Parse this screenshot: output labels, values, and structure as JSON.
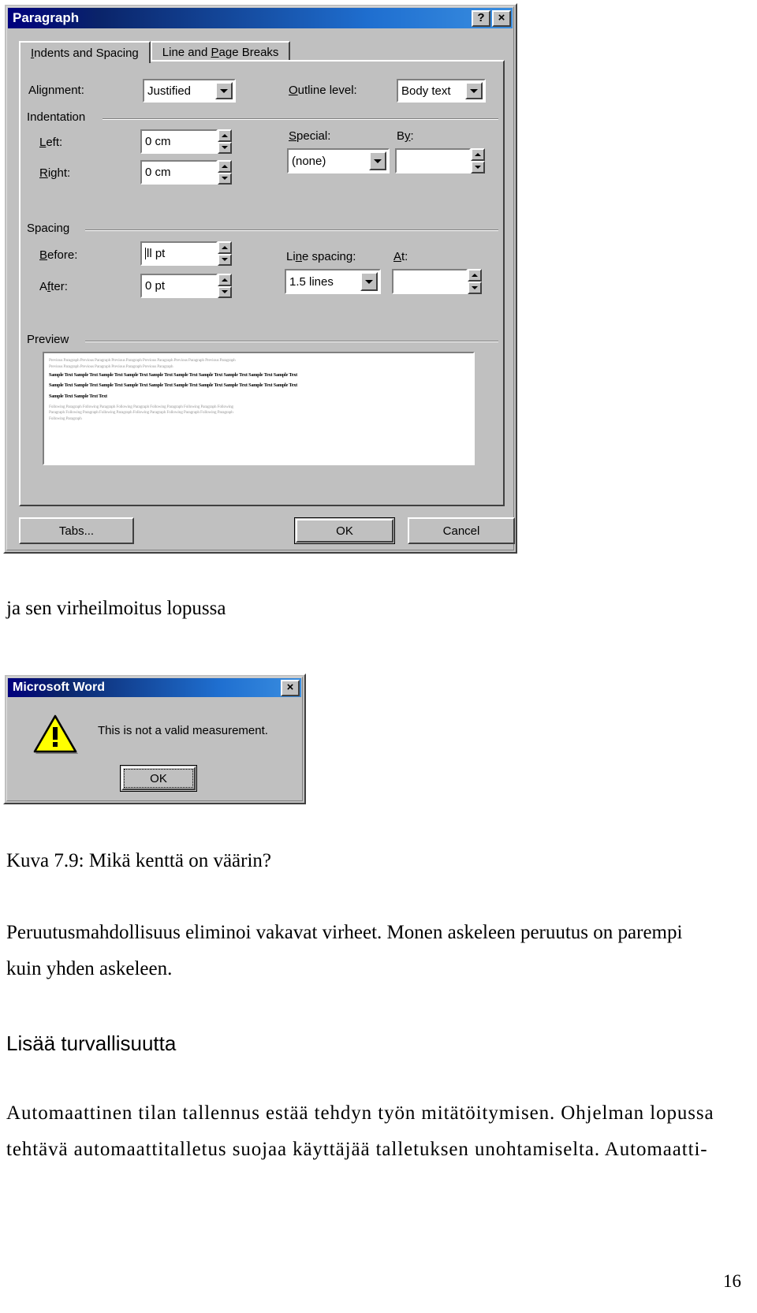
{
  "paragraph_dialog": {
    "title": "Paragraph",
    "help_button": "?",
    "close_button": "×",
    "tabs": [
      {
        "label": "Indents and Spacing",
        "accel": "I",
        "active": true
      },
      {
        "label": "Line and Page Breaks",
        "accel": "P",
        "active": false
      }
    ],
    "alignment": {
      "label": "Alignment:",
      "accel": "g",
      "value": "Justified"
    },
    "outline_level": {
      "label": "Outline level:",
      "accel": "O",
      "value": "Body text"
    },
    "indentation": {
      "group_label": "Indentation",
      "left": {
        "label": "Left:",
        "accel": "L",
        "value": "0 cm"
      },
      "right": {
        "label": "Right:",
        "accel": "R",
        "value": "0 cm"
      },
      "special": {
        "label": "Special:",
        "accel": "S",
        "value": "(none)"
      },
      "by": {
        "label": "By:",
        "accel": "y",
        "value": ""
      }
    },
    "spacing": {
      "group_label": "Spacing",
      "before": {
        "label": "Before:",
        "accel": "B",
        "value": "ll pt"
      },
      "after": {
        "label": "After:",
        "accel": "f",
        "value": "0 pt"
      },
      "line_spacing": {
        "label": "Line spacing:",
        "accel": "n",
        "value": "1.5 lines"
      },
      "at": {
        "label": "At:",
        "accel": "A",
        "value": ""
      }
    },
    "preview": {
      "group_label": "Preview",
      "previous_lines": [
        "Previous Paragraph Previous Paragraph Previous Paragraph Previous Paragraph Previous Paragraph Previous Paragraph",
        "Previous Paragraph Previous Paragraph Previous Paragraph Previous Paragraph"
      ],
      "sample_lines": [
        "Sample Text Sample Text Sample Text Sample Text Sample Text Sample Text Sample Text Sample Text Sample Text Sample Text",
        "Sample Text  Sample Text  Sample Text  Sample Text  Sample Text  Sample Text  Sample Text  Sample Text  Sample Text  Sample Text",
        "Sample Text Sample Text Text"
      ],
      "following_lines": [
        "Following Paragraph Following Paragraph Following Paragraph Following Paragraph Following Paragraph Following",
        "Paragraph Following Paragraph Following Paragraph Following Paragraph Following Paragraph Following Paragraph",
        "Following Paragraph"
      ]
    },
    "buttons": {
      "tabs": "Tabs...",
      "ok": "OK",
      "cancel": "Cancel"
    }
  },
  "word_dialog": {
    "title": "Microsoft Word",
    "close_button": "×",
    "icon": "warning-triangle-icon",
    "message": "This is not a valid measurement.",
    "ok_button": "OK"
  },
  "document": {
    "caption_above": "ja sen virheilmoitus lopussa",
    "figure_caption": "Kuva 7.9: Mikä kenttä on väärin?",
    "paragraph_1_line_1": "Peruutusmahdollisuus eliminoi vakavat virheet. Monen askeleen peruutus on parempi",
    "paragraph_1_line_2": "kuin yhden askeleen.",
    "heading": "Lisää turvallisuutta",
    "paragraph_2_line_1": "Automaattinen tilan tallennus estää tehdyn työn mitätöitymisen. Ohjelman lopussa",
    "paragraph_2_line_2": "tehtävä automaattitalletus suojaa käyttäjää talletuksen unohtamiselta. Automaatti-",
    "page_number": "16"
  },
  "colors": {
    "title_bar_start": "#00007e",
    "title_bar_end": "#3a8ee0",
    "dialog_face": "#c0c0c0",
    "warning_yellow": "#ffff00",
    "text": "#000000"
  }
}
